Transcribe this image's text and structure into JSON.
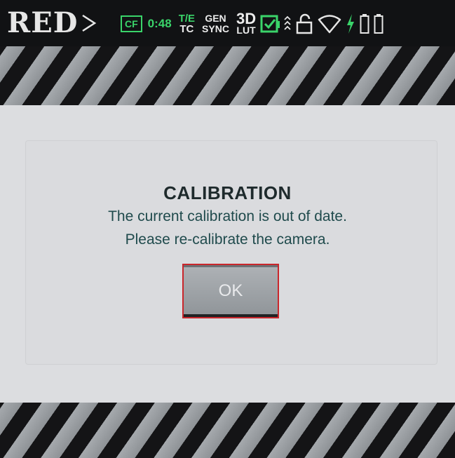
{
  "status_bar": {
    "logo_text": "RED",
    "media_label": "CF",
    "record_time": "0:48",
    "te_label": "T/E",
    "tc_label": "TC",
    "gen_label": "GEN",
    "sync_label": "SYNC",
    "lut_top": "3D",
    "lut_bottom": "LUT",
    "icons": [
      "logo-arrow-icon",
      "checkbox-icon",
      "signal-chevrons-icon",
      "unlock-icon",
      "wifi-icon",
      "bolt-icon",
      "battery-icon",
      "battery-icon"
    ],
    "accent_color": "#3ad46a"
  },
  "dialog": {
    "title": "CALIBRATION",
    "line1": "The current calibration is out of date.",
    "line2": "Please re-calibrate the camera.",
    "ok_label": "OK",
    "ok_border_color": "#c9262b"
  }
}
